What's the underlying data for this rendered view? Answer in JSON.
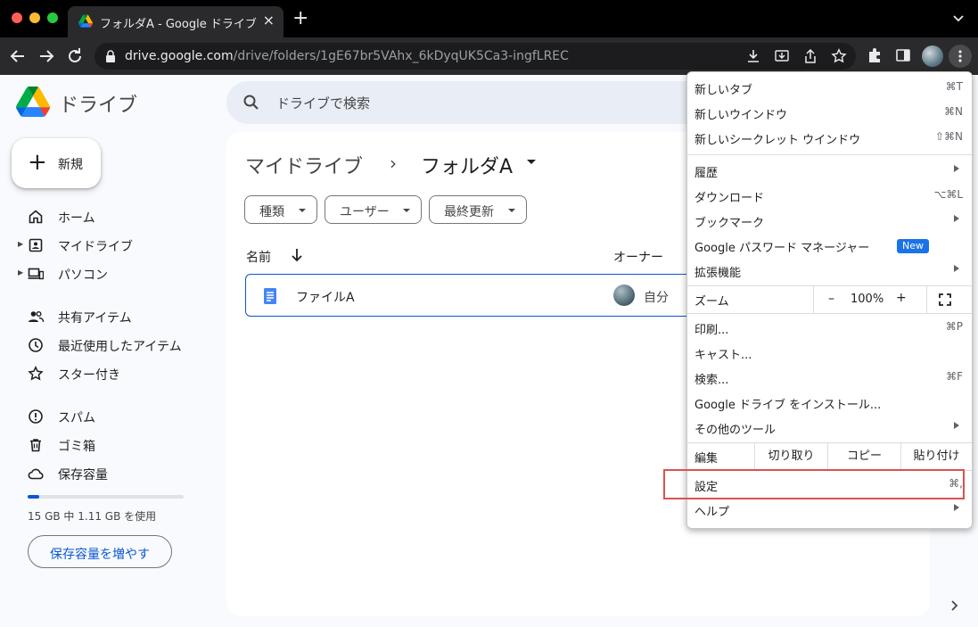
{
  "browser": {
    "tab_title": "フォルダA - Google ドライブ",
    "new_tab": "+",
    "url_host": "drive.google.com",
    "url_path": "/drive/folders/1gE67br5VAhx_6kDyqUK5Ca3-ingfLREC"
  },
  "drive": {
    "app_name": "ドライブ",
    "search_placeholder": "ドライブで検索",
    "new_button": "新規",
    "sidebar": [
      {
        "label": "ホーム",
        "icon": "home-icon"
      },
      {
        "label": "マイドライブ",
        "icon": "my-drive-icon"
      },
      {
        "label": "パソコン",
        "icon": "computers-icon"
      },
      {
        "label": "共有アイテム",
        "icon": "shared-icon"
      },
      {
        "label": "最近使用したアイテム",
        "icon": "recent-icon"
      },
      {
        "label": "スター付き",
        "icon": "star-icon"
      },
      {
        "label": "スパム",
        "icon": "spam-icon"
      },
      {
        "label": "ゴミ箱",
        "icon": "trash-icon"
      },
      {
        "label": "保存容量",
        "icon": "cloud-icon"
      }
    ],
    "storage": {
      "text": "15 GB 中 1.11 GB を使用",
      "used_fraction": 0.074,
      "button": "保存容量を増やす"
    },
    "breadcrumb": {
      "root": "マイドライブ",
      "separator": "›",
      "current": "フォルダA"
    },
    "filters": [
      "種類",
      "ユーザー",
      "最終更新"
    ],
    "columns": {
      "name": "名前",
      "owner": "オーナー"
    },
    "files": [
      {
        "name": "ファイルA",
        "owner": "自分",
        "icon": "google-doc-icon"
      }
    ],
    "accent_color": "#0b57d0"
  },
  "chrome_menu": {
    "items": [
      {
        "label": "新しいタブ",
        "shortcut": "⌘T"
      },
      {
        "label": "新しいウインドウ",
        "shortcut": "⌘N"
      },
      {
        "label": "新しいシークレット ウインドウ",
        "shortcut": "⇧⌘N"
      },
      {
        "label": "履歴",
        "submenu": true
      },
      {
        "label": "ダウンロード",
        "shortcut": "⌥⌘L"
      },
      {
        "label": "ブックマーク",
        "submenu": true
      },
      {
        "label": "Google パスワード マネージャー",
        "badge": "New"
      },
      {
        "label": "拡張機能",
        "submenu": true
      },
      {
        "label": "印刷...",
        "shortcut": "⌘P"
      },
      {
        "label": "キャスト..."
      },
      {
        "label": "検索...",
        "shortcut": "⌘F"
      },
      {
        "label": "Google ドライブ をインストール..."
      },
      {
        "label": "その他のツール",
        "submenu": true
      },
      {
        "label": "設定",
        "shortcut": "⌘,",
        "highlighted": true
      },
      {
        "label": "ヘルプ",
        "submenu": true
      }
    ],
    "zoom": {
      "label": "ズーム",
      "minus": "–",
      "value": "100%",
      "plus": "+"
    },
    "edit": {
      "label": "編集",
      "cut": "切り取り",
      "copy": "コピー",
      "paste": "貼り付け"
    },
    "highlight_color": "#d9534f"
  }
}
